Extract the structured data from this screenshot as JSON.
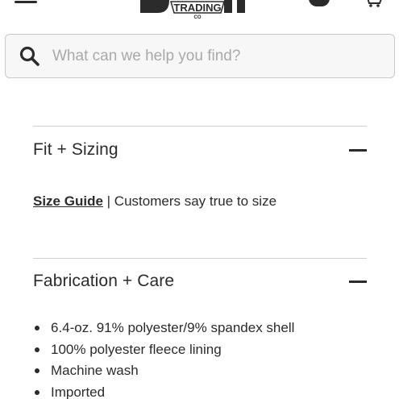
{
  "header": {
    "logo_text": "TRADING",
    "logo_subtext": "CO"
  },
  "search": {
    "placeholder": "What can we help you find?",
    "value": ""
  },
  "sections": {
    "fit": {
      "title": "Fit + Sizing",
      "size_guide_label": "Size Guide",
      "separator": " | ",
      "note": "Customers say true to size"
    },
    "fabrication": {
      "title": "Fabrication + Care",
      "items": [
        "6.4-oz. 91% polyester/9% spandex shell",
        "100% polyester fleece lining",
        "Machine wash",
        "Imported"
      ]
    }
  },
  "colors": {
    "text": "#2b2b2b",
    "placeholder": "#a9a9a9",
    "divider": "#cfcfcf",
    "search_bg": "#f7f7f7"
  }
}
